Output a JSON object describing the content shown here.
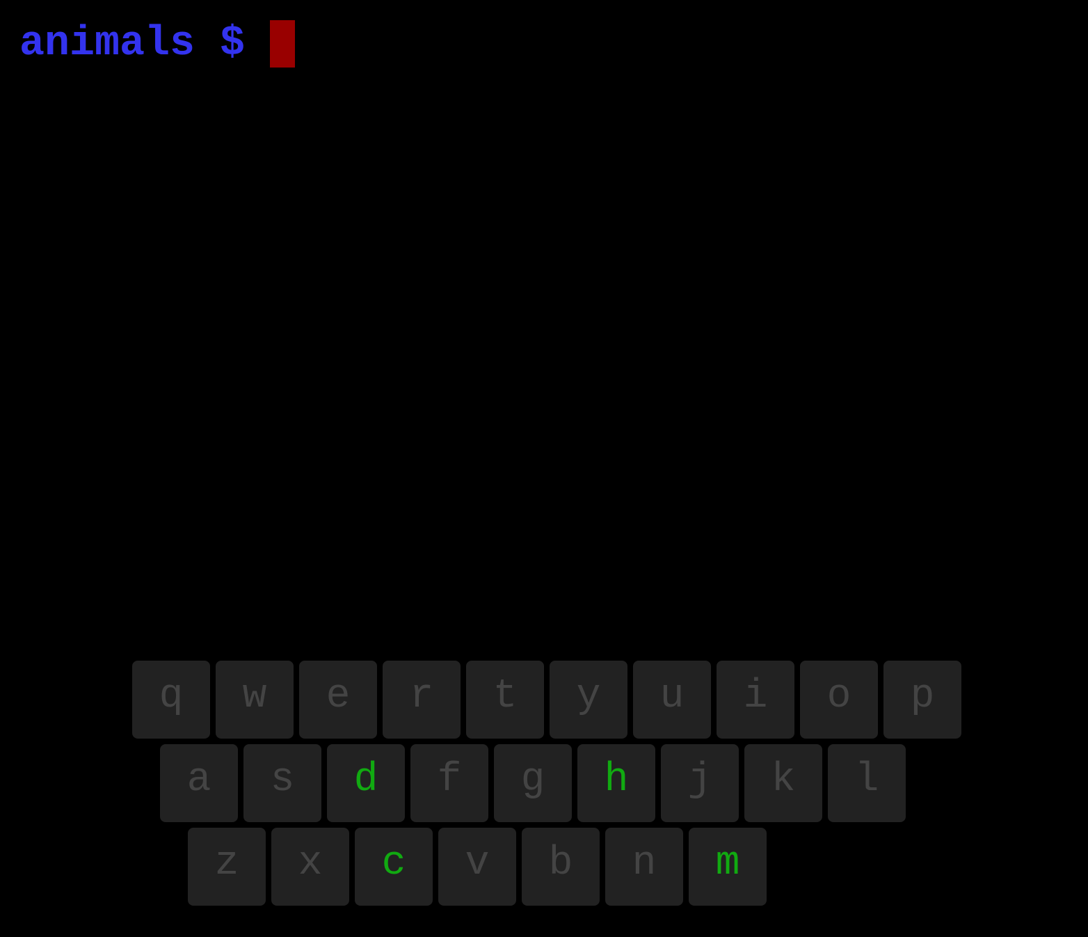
{
  "terminal": {
    "prompt": "animals $",
    "input": ""
  },
  "keyboard": {
    "rows": [
      [
        {
          "letter": "q",
          "state": "unused"
        },
        {
          "letter": "w",
          "state": "unused"
        },
        {
          "letter": "e",
          "state": "unused"
        },
        {
          "letter": "r",
          "state": "unused"
        },
        {
          "letter": "t",
          "state": "unused"
        },
        {
          "letter": "y",
          "state": "unused"
        },
        {
          "letter": "u",
          "state": "unused"
        },
        {
          "letter": "i",
          "state": "unused"
        },
        {
          "letter": "o",
          "state": "unused"
        },
        {
          "letter": "p",
          "state": "unused"
        }
      ],
      [
        {
          "letter": "a",
          "state": "unused"
        },
        {
          "letter": "s",
          "state": "unused"
        },
        {
          "letter": "d",
          "state": "correct"
        },
        {
          "letter": "f",
          "state": "unused"
        },
        {
          "letter": "g",
          "state": "unused"
        },
        {
          "letter": "h",
          "state": "correct"
        },
        {
          "letter": "j",
          "state": "unused"
        },
        {
          "letter": "k",
          "state": "unused"
        },
        {
          "letter": "l",
          "state": "unused"
        }
      ],
      [
        {
          "letter": "z",
          "state": "unused"
        },
        {
          "letter": "x",
          "state": "unused"
        },
        {
          "letter": "c",
          "state": "correct"
        },
        {
          "letter": "v",
          "state": "unused"
        },
        {
          "letter": "b",
          "state": "unused"
        },
        {
          "letter": "n",
          "state": "unused"
        },
        {
          "letter": "m",
          "state": "correct"
        }
      ]
    ]
  },
  "colors": {
    "background": "#000000",
    "prompt": "#3333ee",
    "cursor": "#990000",
    "key_background": "#222222",
    "key_unused": "#444444",
    "key_correct": "#11aa11"
  }
}
